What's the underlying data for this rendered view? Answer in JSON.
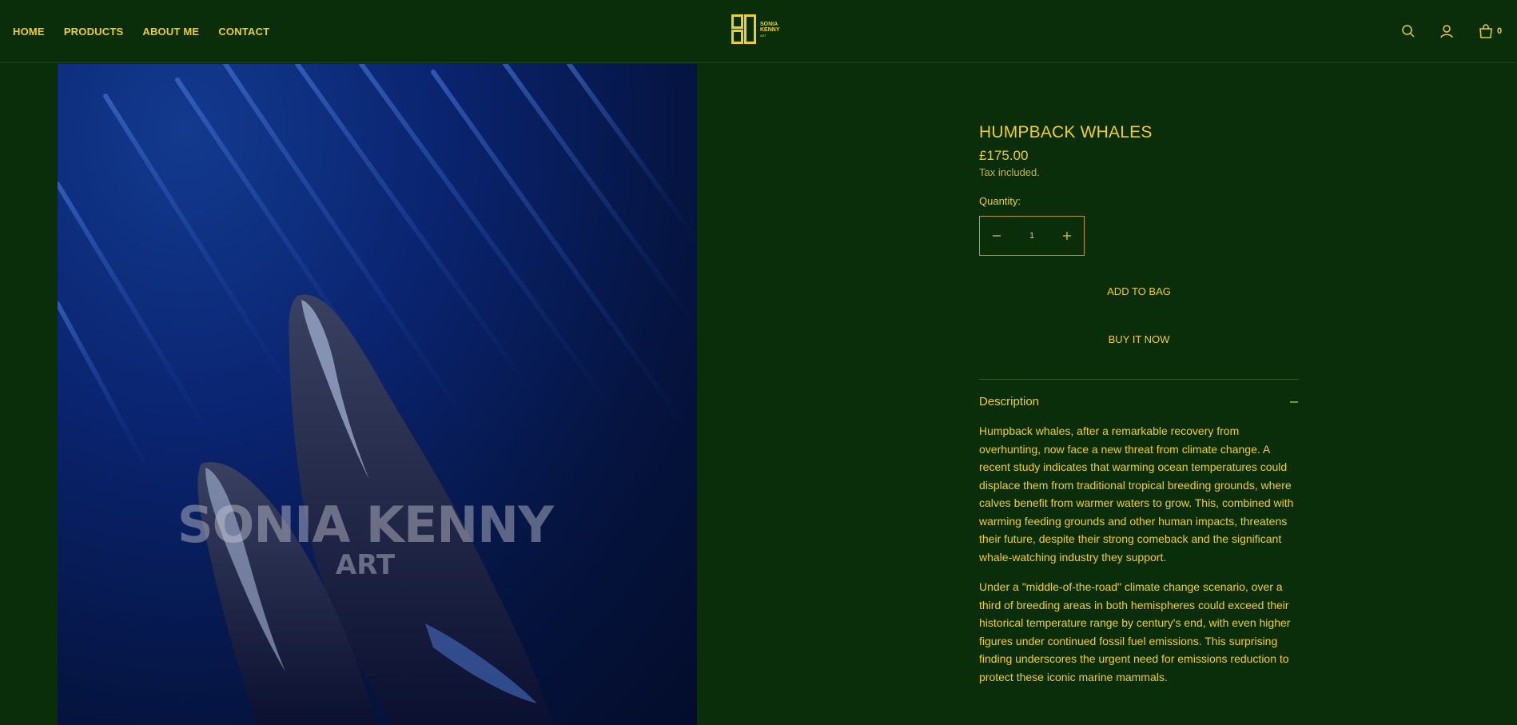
{
  "nav": {
    "items": [
      "HOME",
      "PRODUCTS",
      "ABOUT ME",
      "CONTACT"
    ]
  },
  "brand": {
    "line1": "SONIA",
    "line2": "KENNY",
    "line3": "ART"
  },
  "header": {
    "cart_count": "0",
    "icons": [
      "search-icon",
      "account-icon",
      "bag-icon"
    ]
  },
  "hero": {
    "watermark_line1": "SONIA KENNY",
    "watermark_line2": "ART"
  },
  "product": {
    "title": "HUMPBACK WHALES",
    "price": "£175.00",
    "tax_note": "Tax included.",
    "quantity_label": "Quantity:",
    "quantity_value": "1",
    "add_to_bag": "ADD TO BAG",
    "buy_now": "BUY IT NOW",
    "description_title": "Description",
    "description": [
      "Humpback whales, after a remarkable recovery from overhunting, now face a new threat from climate change. A recent study indicates that warming ocean temperatures could displace them from traditional tropical breeding grounds, where calves benefit from warmer waters to grow. This, combined with warming feeding grounds and other human impacts, threatens their future, despite their strong comeback and the significant whale-watching industry they support.",
      " Under a \"middle-of-the-road\" climate change scenario, over a third of breeding areas in both hemispheres could exceed their historical temperature range by century's end, with even higher figures under continued fossil fuel emissions. This surprising finding underscores the urgent need for emissions reduction to protect these iconic marine mammals."
    ]
  },
  "colors": {
    "background": "#0a2e0a",
    "accent": "#f1cc2b",
    "ocean": "#0a2470"
  }
}
